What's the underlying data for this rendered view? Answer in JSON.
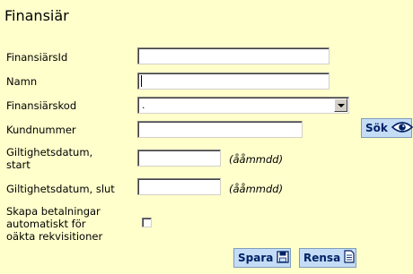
{
  "title": "Finansiär",
  "fields": {
    "finansiars_id": {
      "label": "FinansiärsId",
      "value": ""
    },
    "namn": {
      "label": "Namn",
      "value": ""
    },
    "finansiarskod": {
      "label": "Finansiärskod",
      "selected": "."
    },
    "kundnummer": {
      "label": "Kundnummer",
      "value": ""
    },
    "giltig_start": {
      "label_line1": "Giltighetsdatum,",
      "label_line2": "start",
      "value": "",
      "hint": "(ååmmdd)"
    },
    "giltig_slut": {
      "label": "Giltighetsdatum, slut",
      "value": "",
      "hint": "(ååmmdd)"
    },
    "skapa_betalningar": {
      "label_line1": "Skapa betalningar",
      "label_line2": "automatiskt för",
      "label_line3": "oäkta rekvisitioner",
      "checked": false
    }
  },
  "buttons": {
    "sok": "Sök",
    "spara": "Spara",
    "rensa": "Rensa"
  },
  "icons": {
    "sok": "eye-icon",
    "spara": "floppy-disk-icon",
    "rensa": "document-icon"
  },
  "colors": {
    "background": "#ffffcc",
    "button_bg": "#c4dcf6",
    "button_text": "#002266"
  }
}
